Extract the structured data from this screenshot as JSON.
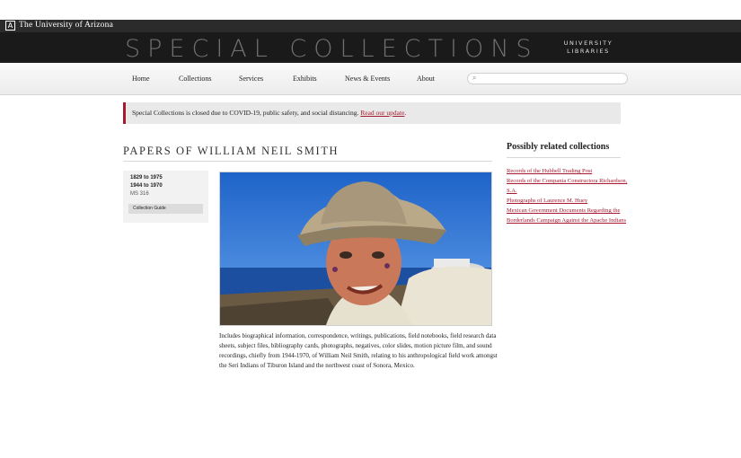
{
  "topbar": {
    "university": "The University of Arizona",
    "logo_glyph": "A"
  },
  "header": {
    "title": "SPECIAL COLLECTIONS",
    "libraries": [
      "UNIVERSITY",
      "LIBRARIES"
    ]
  },
  "nav": {
    "items": [
      "Home",
      "Collections",
      "Services",
      "Exhibits",
      "News & Events",
      "About"
    ],
    "search_icon": "search-icon"
  },
  "alert": {
    "text": "Special Collections is closed due to COVID-19, public safety, and social distancing.",
    "link": "Read our update",
    "suffix": "."
  },
  "collection": {
    "title": "PAPERS OF WILLIAM NEIL SMITH",
    "date_range": "1829 to 1975",
    "bulk_dates": "1944 to 1970",
    "ms_number": "MS 316",
    "guide_button": "Collection Guide",
    "description": "Includes biographical information, correspondence, writings, publications, field notebooks, field research data sheets, subject files, bibliography cards, photographs, negatives, color slides, motion picture film, and sound recordings, chiefly from 1944-1970, of William Neil Smith, relating to his anthropological field work amongst the Seri Indians of Tiburon Island and the northwest coast of Sonora, Mexico."
  },
  "related": {
    "title": "Possibly related collections",
    "items": [
      "Records of the Hubbell Trading Post",
      "Records of the Compania Constructora Richardson, S.A.",
      "Photographs of Laurence M. Huey",
      "Mexican Government Documents Regarding the Borderlands Campaign Against the Apache Indians"
    ]
  },
  "colors": {
    "accent": "#a6192e",
    "header_bg": "#1a1a1a",
    "topbar_bg": "#2b2b2b"
  }
}
